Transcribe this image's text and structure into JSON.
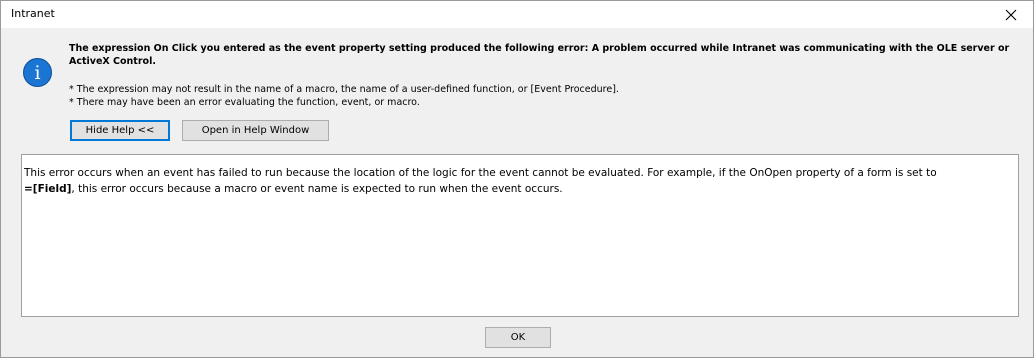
{
  "window": {
    "title": "Intranet"
  },
  "message": {
    "main": "The expression On Click you entered as the event property setting produced the following error: A problem occurred while Intranet was communicating with the OLE server or ActiveX Control.",
    "detail_lines": [
      "* The expression may not result in the name of a macro, the name of a user-defined function, or [Event Procedure].",
      "* There may have been an error evaluating the function, event, or macro."
    ],
    "icon": "info-icon"
  },
  "buttons": {
    "hide_help": "Hide Help <<",
    "open_help": "Open in Help Window",
    "ok": "OK"
  },
  "help": {
    "text_before": "This error occurs when an event has failed to run because the location of the logic for the event cannot be evaluated. For example, if the OnOpen property of a form is set to",
    "bold_token": "=[Field]",
    "text_after": ", this error occurs because a macro or event name is expected to run when the event occurs."
  },
  "colors": {
    "accent": "#0078d7",
    "info_icon": "#1a76d2"
  }
}
